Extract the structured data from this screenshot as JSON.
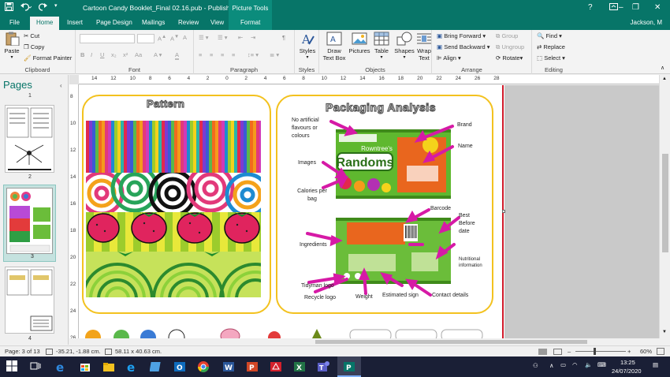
{
  "titlebar": {
    "title": "Cartoon Candy Booklet_Final 02.16.pub - Publisher",
    "context_tab_group": "Picture Tools",
    "help": "?",
    "minimize": "–",
    "restore": "❐",
    "close": "✕"
  },
  "tabs": {
    "file": "File",
    "home": "Home",
    "insert": "Insert",
    "page_design": "Page Design",
    "mailings": "Mailings",
    "review": "Review",
    "view": "View",
    "format": "Format",
    "user": "Jackson, M"
  },
  "ribbon": {
    "clipboard": {
      "paste": "Paste",
      "cut": "Cut",
      "copy": "Copy",
      "format_painter": "Format Painter",
      "label": "Clipboard"
    },
    "font": {
      "bold": "B",
      "italic": "I",
      "underline": "U",
      "strike": "x₂",
      "super": "x²",
      "case": "Aa",
      "label": "Font"
    },
    "paragraph": {
      "label": "Paragraph",
      "pilcrow": "¶"
    },
    "styles": {
      "styles": "Styles",
      "label": "Styles"
    },
    "objects": {
      "draw_text_box": "Draw Text Box",
      "pictures": "Pictures",
      "table": "Table",
      "shapes": "Shapes",
      "label": "Objects"
    },
    "arrange": {
      "wrap_text": "Wrap Text",
      "bring_forward": "Bring Forward",
      "send_backward": "Send Backward",
      "align": "Align",
      "group": "Group",
      "ungroup": "Ungroup",
      "rotate": "Rotate",
      "label": "Arrange"
    },
    "editing": {
      "find": "Find",
      "replace": "Replace",
      "select": "Select",
      "label": "Editing"
    }
  },
  "pages_pane": {
    "title": "Pages",
    "collapse": "‹",
    "pages": [
      "1",
      "2",
      "3",
      "4"
    ]
  },
  "ruler": {
    "h_ticks": [
      "14",
      "12",
      "10",
      "8",
      "6",
      "4",
      "2",
      "0",
      "2",
      "4",
      "6",
      "8",
      "10",
      "12",
      "14",
      "16",
      "18",
      "20",
      "22",
      "24",
      "26",
      "28"
    ],
    "v_ticks": [
      "8",
      "10",
      "12",
      "14",
      "16",
      "18",
      "20",
      "22",
      "24",
      "26"
    ]
  },
  "document": {
    "pattern_title": "Pattern",
    "packaging_title": "Packaging Analysis",
    "labels": {
      "no_artificial": "No artificial flavours or colours",
      "brand": "Brand",
      "name": "Name",
      "images": "Images",
      "calories": "Calories per bag",
      "barcode": "Barcode",
      "best_before": "Best Before date",
      "ingredients": "Ingredients",
      "nutritional": "Nutritional information",
      "tidyman": "Tidyman logo",
      "recycle": "Recycle logo",
      "weight": "Weight",
      "estimated": "Estimated sign",
      "contact": "Contact details"
    },
    "packet_brand": "Rowntree's",
    "packet_name": "Randoms"
  },
  "status": {
    "page": "Page: 3 of 13",
    "position": "-35.21, -1.88 cm.",
    "size": "58.11 x 40.63 cm.",
    "zoom": "60%"
  },
  "taskbar": {
    "time": "13:25",
    "date": "24/07/2020"
  },
  "colors": {
    "accent": "#077568",
    "panel_border": "#f3c21f",
    "arrow": "#d61aa6",
    "guide": "#d11a2a"
  }
}
